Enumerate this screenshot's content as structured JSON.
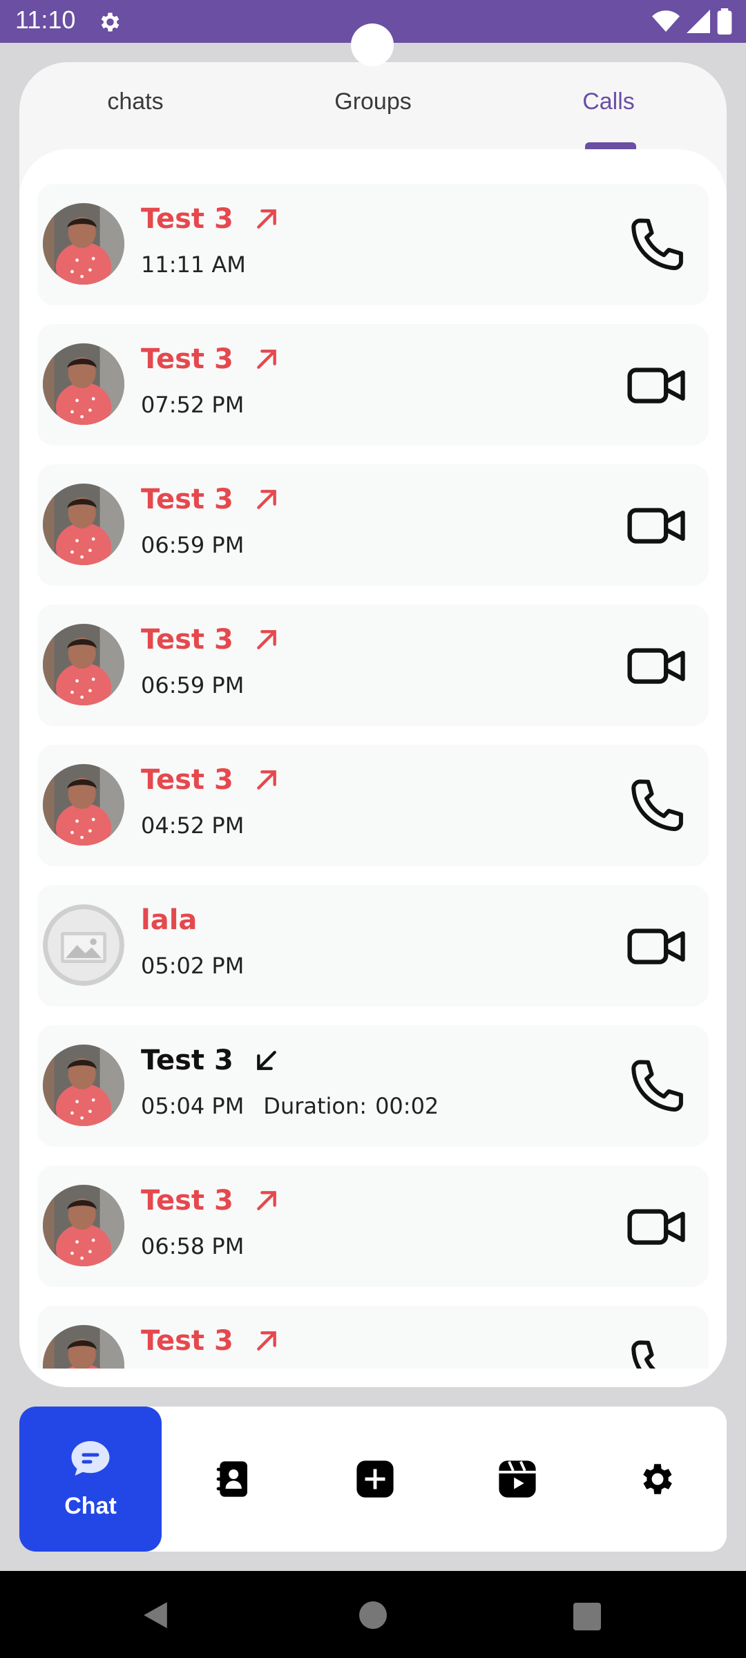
{
  "status_bar": {
    "time": "11:10"
  },
  "tabs": [
    {
      "label": "chats",
      "active": false
    },
    {
      "label": "Groups",
      "active": false
    },
    {
      "label": "Calls",
      "active": true
    }
  ],
  "calls": [
    {
      "name": "Test 3",
      "direction": "outgoing",
      "time": "11:11 AM",
      "type": "voice",
      "avatar": "child-photo"
    },
    {
      "name": "Test 3",
      "direction": "outgoing",
      "time": "07:52 PM",
      "type": "video",
      "avatar": "child-photo"
    },
    {
      "name": "Test 3",
      "direction": "outgoing",
      "time": "06:59 PM",
      "type": "video",
      "avatar": "child-photo"
    },
    {
      "name": "Test 3",
      "direction": "outgoing",
      "time": "06:59 PM",
      "type": "video",
      "avatar": "child-photo"
    },
    {
      "name": "Test 3",
      "direction": "outgoing",
      "time": "04:52 PM",
      "type": "voice",
      "avatar": "child-photo"
    },
    {
      "name": "lala",
      "direction": "none",
      "time": "05:02 PM",
      "type": "video",
      "avatar": "placeholder"
    },
    {
      "name": "Test 3",
      "direction": "incoming",
      "time": "05:04 PM",
      "duration_label": "Duration:",
      "duration": "00:02",
      "type": "voice",
      "avatar": "child-photo"
    },
    {
      "name": "Test 3",
      "direction": "outgoing",
      "time": "06:58 PM",
      "type": "video",
      "avatar": "child-photo"
    },
    {
      "name": "Test 3",
      "direction": "outgoing",
      "time": "",
      "type": "voice",
      "avatar": "child-photo"
    }
  ],
  "bottom_nav": {
    "chat_label": "Chat",
    "items": [
      "chat-bubble-icon",
      "contacts-book-icon",
      "add-square-icon",
      "reels-icon",
      "settings-gear-icon"
    ]
  },
  "colors": {
    "accent": "#6a4fa3",
    "missed_red": "#e5484d",
    "nav_active": "#2347e6"
  }
}
